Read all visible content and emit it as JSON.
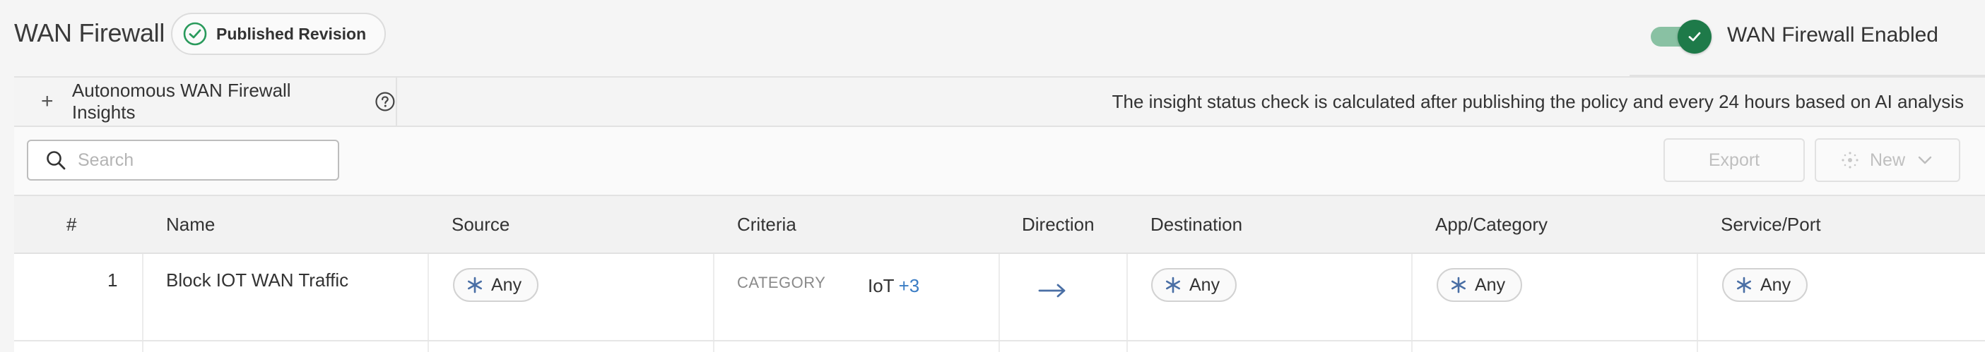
{
  "header": {
    "title": "WAN Firewall",
    "revision_badge": "Published Revision",
    "toggle_label": "WAN Firewall Enabled",
    "toggle_on": true
  },
  "insights": {
    "expand_icon": "+",
    "label": "Autonomous WAN Firewall Insights",
    "note": "The insight status check is calculated after publishing the policy and every 24 hours based on AI analysis"
  },
  "toolbar": {
    "search_placeholder": "Search",
    "export_label": "Export",
    "new_label": "New"
  },
  "table": {
    "columns": {
      "num": "#",
      "name": "Name",
      "source": "Source",
      "criteria": "Criteria",
      "direction": "Direction",
      "destination": "Destination",
      "app": "App/Category",
      "service": "Service/Port"
    },
    "rows": [
      {
        "num": "1",
        "name": "Block IOT WAN Traffic",
        "source": "Any",
        "criteria_label": "CATEGORY",
        "criteria_value": "IoT",
        "criteria_more": "+3",
        "destination": "Any",
        "app": "Any",
        "service": "Any"
      }
    ]
  },
  "colors": {
    "accent_green": "#1e7a49",
    "link_blue": "#3a7cc4",
    "any_icon": "#4a6fa5"
  }
}
